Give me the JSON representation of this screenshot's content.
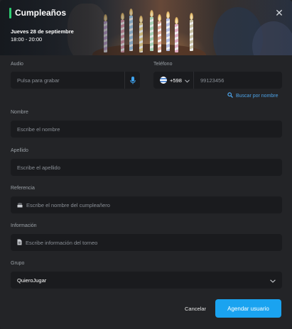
{
  "header": {
    "title": "Cumpleaños",
    "date": "Jueves 28 de septiembre",
    "time": "18:00 - 20:00",
    "accent_color": "#2ecc71"
  },
  "audio": {
    "label": "Audio",
    "placeholder": "Pulsa para grabar",
    "icon": "microphone-icon"
  },
  "phone": {
    "label": "Teléfono",
    "country_code": "+598",
    "placeholder": "99123456",
    "search_link": "Buscar por nombre",
    "flag_icon": "uruguay-flag-icon"
  },
  "nombre": {
    "label": "Nombre",
    "placeholder": "Escribe el nombre"
  },
  "apellido": {
    "label": "Apellido",
    "placeholder": "Escribe el apellido"
  },
  "referencia": {
    "label": "Referencia",
    "placeholder": "Escribe el nombre del cumpleañero",
    "icon": "cake-icon"
  },
  "informacion": {
    "label": "Información",
    "placeholder": "Escribe información del torneo",
    "icon": "document-icon"
  },
  "grupo": {
    "label": "Grupo",
    "value": "QuieroJugar"
  },
  "actions": {
    "cancel": "Cancelar",
    "submit": "Agendar usuario",
    "submit_color": "#1aa3f0"
  }
}
